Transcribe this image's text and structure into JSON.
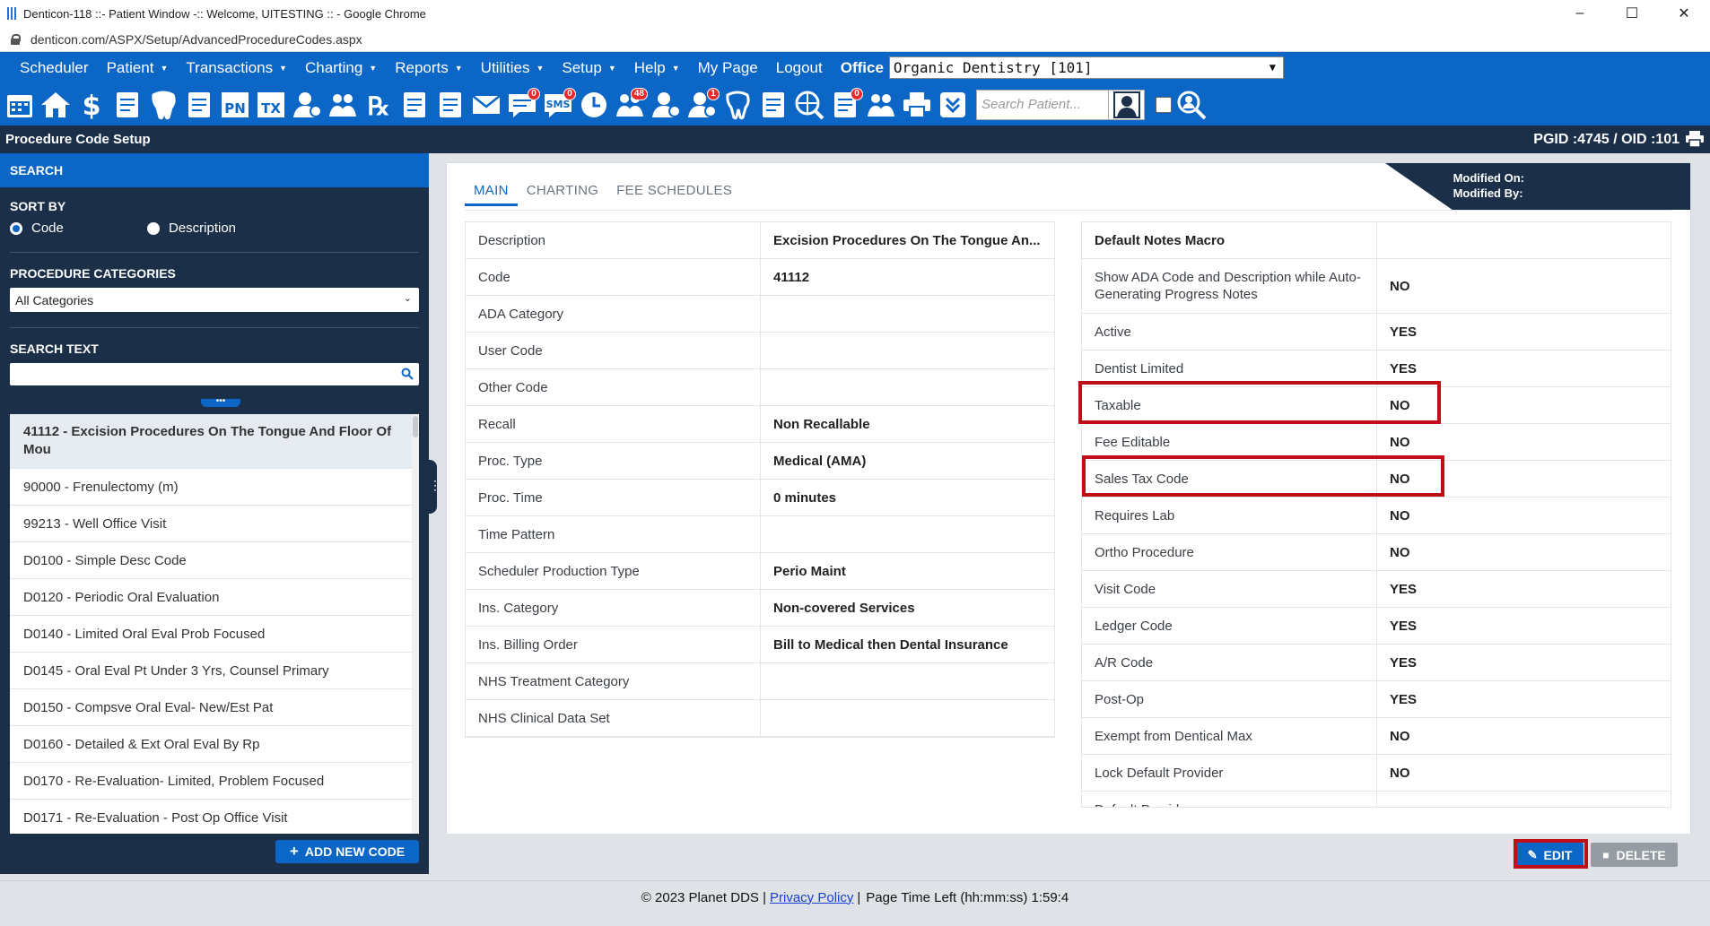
{
  "window": {
    "title": "Denticon-118 ::- Patient Window -:: Welcome, UITESTING :: - Google Chrome",
    "url": "denticon.com/ASPX/Setup/AdvancedProcedureCodes.aspx",
    "controls": [
      "–",
      "☐",
      "✕"
    ]
  },
  "menubar": {
    "items": [
      {
        "label": "Scheduler",
        "caret": false
      },
      {
        "label": "Patient",
        "caret": true
      },
      {
        "label": "Transactions",
        "caret": true
      },
      {
        "label": "Charting",
        "caret": true
      },
      {
        "label": "Reports",
        "caret": true
      },
      {
        "label": "Utilities",
        "caret": true
      },
      {
        "label": "Setup",
        "caret": true
      },
      {
        "label": "Help",
        "caret": true
      },
      {
        "label": "My Page",
        "caret": false
      },
      {
        "label": "Logout",
        "caret": false
      }
    ],
    "office_label": "Office",
    "office_value": "Organic Dentistry [101]"
  },
  "toolbar": {
    "icons": [
      {
        "name": "calendar-icon",
        "badge": ""
      },
      {
        "name": "home-icon",
        "badge": ""
      },
      {
        "name": "dollar-icon",
        "badge": ""
      },
      {
        "name": "clipboard-pen-icon",
        "badge": ""
      },
      {
        "name": "tooth-icon",
        "badge": ""
      },
      {
        "name": "dental-chart-icon",
        "badge": ""
      },
      {
        "name": "pn-icon",
        "badge": ""
      },
      {
        "name": "tx-icon",
        "badge": ""
      },
      {
        "name": "add-patient-icon",
        "badge": ""
      },
      {
        "name": "add-family-icon",
        "badge": ""
      },
      {
        "name": "rx-icon",
        "badge": ""
      },
      {
        "name": "notes-icon",
        "badge": ""
      },
      {
        "name": "document-icon",
        "badge": ""
      },
      {
        "name": "mail-icon",
        "badge": ""
      },
      {
        "name": "chat-icon",
        "badge": "0"
      },
      {
        "name": "sms-icon",
        "badge": "0"
      },
      {
        "name": "clock-icon",
        "badge": ""
      },
      {
        "name": "globe-users-icon",
        "badge": "48"
      },
      {
        "name": "support-icon",
        "badge": ""
      },
      {
        "name": "alert-person-icon",
        "badge": "1"
      },
      {
        "name": "tooth-outline-icon",
        "badge": ""
      },
      {
        "name": "help-doc-icon",
        "badge": ""
      },
      {
        "name": "web-search-icon",
        "badge": ""
      },
      {
        "name": "checklist-icon",
        "badge": "0"
      },
      {
        "name": "group-icon",
        "badge": ""
      },
      {
        "name": "printer-icon",
        "badge": ""
      },
      {
        "name": "inbox-down-icon",
        "badge": ""
      }
    ],
    "search_placeholder": "Search Patient..."
  },
  "page": {
    "title": "Procedure Code Setup",
    "ids": "PGID :4745  /  OID :101"
  },
  "left": {
    "header": "SEARCH",
    "sort_by_label": "SORT BY",
    "sort_code": "Code",
    "sort_description": "Description",
    "categories_label": "PROCEDURE CATEGORIES",
    "categories_value": "All Categories",
    "search_text_label": "SEARCH TEXT",
    "grip": "•••",
    "codes": [
      "41112 - Excision Procedures On The Tongue And Floor Of Mou",
      "90000 - Frenulectomy (m)",
      "99213 - Well Office Visit",
      "D0100 - Simple Desc Code",
      "D0120 - Periodic Oral Evaluation",
      "D0140 - Limited Oral Eval Prob Focused",
      "D0145 - Oral Eval Pt Under 3 Yrs, Counsel Primary",
      "D0150 - Compsve Oral Eval- New/Est Pat",
      "D0160 - Detailed & Ext Oral Eval By Rp",
      "D0170 - Re-Evaluation- Limited, Problem Focused",
      "D0171 - Re-Evaluation - Post Op Office Visit"
    ],
    "add_button": "ADD NEW CODE"
  },
  "main": {
    "modified_on": "Modified On:",
    "modified_by": "Modified By:",
    "tabs": [
      "MAIN",
      "CHARTING",
      "FEE SCHEDULES"
    ],
    "left_rows": [
      {
        "k": "Description",
        "v": "Excision Procedures On The Tongue An..."
      },
      {
        "k": "Code",
        "v": "41112"
      },
      {
        "k": "ADA Category",
        "v": ""
      },
      {
        "k": "User Code",
        "v": ""
      },
      {
        "k": "Other Code",
        "v": ""
      },
      {
        "k": "Recall",
        "v": "Non Recallable"
      },
      {
        "k": "Proc. Type",
        "v": "Medical (AMA)"
      },
      {
        "k": "Proc. Time",
        "v": "0 minutes"
      },
      {
        "k": "Time Pattern",
        "v": ""
      },
      {
        "k": "Scheduler Production Type",
        "v": "Perio Maint"
      },
      {
        "k": "Ins. Category",
        "v": "Non-covered Services"
      },
      {
        "k": "Ins. Billing Order",
        "v": "Bill to Medical then Dental Insurance"
      },
      {
        "k": "NHS Treatment Category",
        "v": ""
      },
      {
        "k": "NHS Clinical Data Set",
        "v": ""
      }
    ],
    "right_rows": [
      {
        "k": "Default Notes Macro",
        "v": ""
      },
      {
        "k": "Show ADA Code and Description while Auto-Generating Progress Notes",
        "v": "NO"
      },
      {
        "k": "Active",
        "v": "YES"
      },
      {
        "k": "Dentist Limited",
        "v": "YES"
      },
      {
        "k": "Taxable",
        "v": "NO"
      },
      {
        "k": "Fee Editable",
        "v": "NO"
      },
      {
        "k": "Sales Tax Code",
        "v": "NO"
      },
      {
        "k": "Requires Lab",
        "v": "NO"
      },
      {
        "k": "Ortho Procedure",
        "v": "NO"
      },
      {
        "k": "Visit Code",
        "v": "YES"
      },
      {
        "k": "Ledger Code",
        "v": "YES"
      },
      {
        "k": "A/R Code",
        "v": "YES"
      },
      {
        "k": "Post-Op",
        "v": "YES"
      },
      {
        "k": "Exempt from Dentical Max",
        "v": "NO"
      },
      {
        "k": "Lock Default Provider",
        "v": "NO"
      },
      {
        "k": "Default Provider",
        "v": ""
      }
    ],
    "edit_label": "EDIT",
    "delete_label": "DELETE"
  },
  "footer": {
    "copyright": "© 2023 Planet DDS |",
    "privacy": "Privacy Policy",
    "sep": "|",
    "time_left": "Page Time Left (hh:mm:ss) 1:59:4"
  },
  "colors": {
    "brand_blue": "#0c66c5",
    "navy": "#1b2f49",
    "highlight_red": "#c00d17"
  }
}
